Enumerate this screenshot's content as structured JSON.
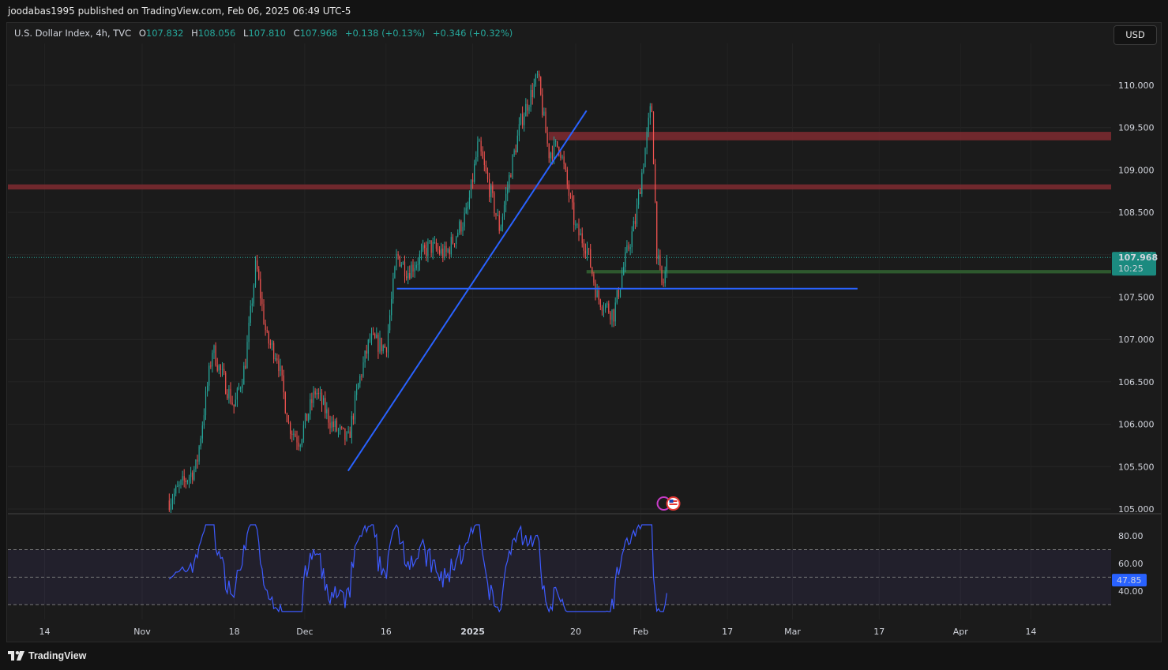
{
  "publisher": "joodabas1995 published on TradingView.com, Feb 06, 2025 06:49 UTC-5",
  "legend": {
    "symbol": "U.S. Dollar Index, 4h, TVC",
    "open_label": "O",
    "open": "107.832",
    "high_label": "H",
    "high": "108.056",
    "low_label": "L",
    "low": "107.810",
    "close_label": "C",
    "close": "107.968",
    "change": "+0.138 (+0.13%)",
    "change2": "+0.346 (+0.32%)"
  },
  "currency_button": "USD",
  "price_tag": {
    "price": "107.968",
    "countdown": "10:25"
  },
  "rsi_tag": "47.85",
  "brand": "TradingView",
  "colors": {
    "up": "#26a69a",
    "down": "#ef5350",
    "trendline": "#2962ff",
    "resistance_zone": "#7a2a30",
    "support_zone": "#2f5d2f",
    "rsi": "#3d5afe"
  },
  "chart_data": [
    {
      "type": "candlestick",
      "title": "U.S. Dollar Index, 4h, TVC",
      "y_ticks": [
        "110.000",
        "109.500",
        "109.000",
        "108.500",
        "108.000",
        "107.500",
        "107.000",
        "106.500",
        "106.000",
        "105.500",
        "105.000"
      ],
      "ylim": [
        105.0,
        110.0
      ],
      "x_ticks": [
        "14",
        "Nov",
        "18",
        "Dec",
        "16",
        "2025",
        "20",
        "Feb",
        "17",
        "Mar",
        "17",
        "Apr",
        "14"
      ],
      "last_price": 107.968,
      "approximate_closes": [
        [
          "Nov 06",
          105.1
        ],
        [
          "Nov 11",
          105.5
        ],
        [
          "Nov 14",
          106.9
        ],
        [
          "Nov 15",
          106.7
        ],
        [
          "Nov 18",
          106.2
        ],
        [
          "Nov 20",
          106.7
        ],
        [
          "Nov 22",
          107.9
        ],
        [
          "Nov 24",
          107.0
        ],
        [
          "Nov 26",
          106.8
        ],
        [
          "Nov 28",
          106.0
        ],
        [
          "Nov 30",
          105.8
        ],
        [
          "Dec 03",
          106.4
        ],
        [
          "Dec 06",
          106.0
        ],
        [
          "Dec 09",
          105.8
        ],
        [
          "Dec 11",
          106.5
        ],
        [
          "Dec 13",
          107.0
        ],
        [
          "Dec 16",
          106.9
        ],
        [
          "Dec 18",
          108.0
        ],
        [
          "Dec 20",
          107.8
        ],
        [
          "Dec 24",
          108.1
        ],
        [
          "Dec 27",
          108.0
        ],
        [
          "Dec 31",
          108.5
        ],
        [
          "Jan 02",
          109.3
        ],
        [
          "Jan 06",
          108.3
        ],
        [
          "Jan 08",
          109.0
        ],
        [
          "Jan 10",
          109.6
        ],
        [
          "Jan 13",
          110.1
        ],
        [
          "Jan 15",
          109.2
        ],
        [
          "Jan 17",
          109.3
        ],
        [
          "Jan 20",
          108.3
        ],
        [
          "Jan 22",
          108.1
        ],
        [
          "Jan 24",
          107.5
        ],
        [
          "Jan 27",
          107.3
        ],
        [
          "Jan 29",
          107.9
        ],
        [
          "Jan 31",
          108.4
        ],
        [
          "Feb 03",
          109.8
        ],
        [
          "Feb 04",
          108.0
        ],
        [
          "Feb 05",
          107.6
        ],
        [
          "Feb 06",
          107.968
        ]
      ],
      "annotations": {
        "resistance_zones": [
          [
            109.35,
            109.45
          ],
          [
            108.77,
            108.83
          ]
        ],
        "support_zone": [
          107.78,
          107.82
        ],
        "horizontal_line": 107.6,
        "trendline": {
          "from": [
            "Dec 09",
            105.45
          ],
          "to": [
            "Jan 22",
            109.7
          ]
        }
      }
    },
    {
      "type": "line",
      "title": "RSI",
      "y_ticks": [
        "80.00",
        "60.00",
        "40.00"
      ],
      "ylim": [
        30,
        85
      ],
      "bands": [
        70,
        50,
        30
      ],
      "last_value": 47.85
    }
  ]
}
